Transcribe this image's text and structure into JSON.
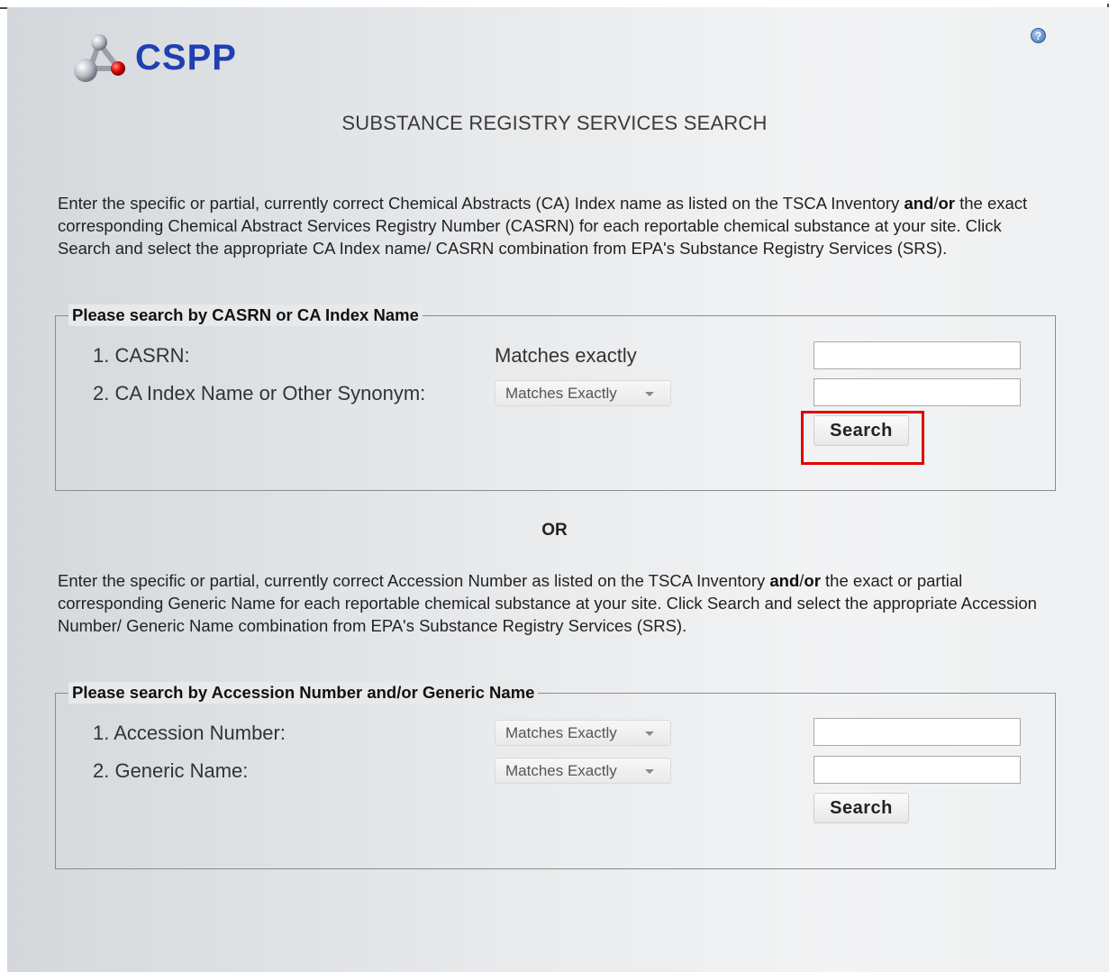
{
  "app": {
    "logo_text": "CSPP",
    "help_icon_glyph": "?"
  },
  "page_title": "SUBSTANCE REGISTRY SERVICES SEARCH",
  "intro1": {
    "part1": "Enter the specific or partial, currently correct Chemical Abstracts (CA) Index name as listed on the TSCA Inventory ",
    "bold1": "and",
    "slash": "/",
    "bold2": "or",
    "part2": " the exact corresponding Chemical Abstract Services Registry Number (CASRN) for each reportable chemical substance at your site. Click Search and select the appropriate CA Index name/ CASRN combination from EPA's Substance Registry Services (SRS)."
  },
  "section1": {
    "legend": "Please search by CASRN or CA Index Name",
    "rows": [
      {
        "label": "1. CASRN:",
        "match": "Matches exactly",
        "value": ""
      },
      {
        "label": "2. CA Index Name or Other Synonym:",
        "match": "Matches Exactly",
        "value": ""
      }
    ],
    "search_label": "Search"
  },
  "or_label": "OR",
  "intro2": {
    "part1": "Enter the specific or partial, currently correct Accession Number as listed on the TSCA Inventory ",
    "bold1": "and",
    "slash": "/",
    "bold2": "or",
    "part2": " the exact or partial corresponding Generic Name for each reportable chemical substance at your site. Click Search and select the appropriate Accession Number/ Generic Name combination from EPA's Substance Registry Services (SRS)."
  },
  "section2": {
    "legend": "Please search by Accession Number and/or Generic Name",
    "rows": [
      {
        "label": "1. Accession Number:",
        "match": "Matches Exactly",
        "value": ""
      },
      {
        "label": "2. Generic Name:",
        "match": "Matches Exactly",
        "value": ""
      }
    ],
    "search_label": "Search"
  },
  "colors": {
    "logo_blue": "#1f3fb3",
    "highlight_red": "#e00000",
    "help_blue": "#3d6fb8"
  }
}
